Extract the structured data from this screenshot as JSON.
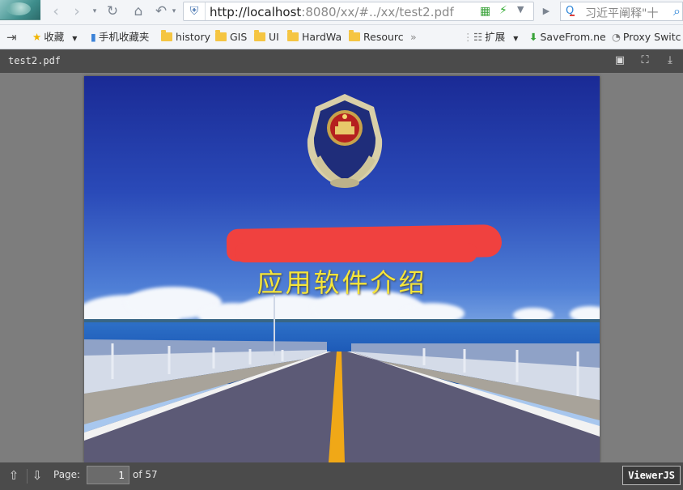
{
  "browser": {
    "url_host": "http://localhost",
    "url_rest": ":8080/xx/#../xx/test2.pdf",
    "search_text": "习近平阐释\"十",
    "back_icon": "back-arrow-icon",
    "forward_icon": "forward-arrow-icon",
    "refresh_icon": "refresh-icon",
    "home_icon": "home-icon",
    "undo_icon": "undo-icon"
  },
  "bookmarks": [
    {
      "label": "收藏",
      "icon": "star-add-icon"
    },
    {
      "label": "手机收藏夹",
      "icon": "phone-icon"
    },
    {
      "label": "history",
      "icon": "folder-icon"
    },
    {
      "label": "GIS",
      "icon": "folder-icon"
    },
    {
      "label": "UI",
      "icon": "folder-icon"
    },
    {
      "label": "HardWa",
      "icon": "folder-icon"
    },
    {
      "label": "Resourc",
      "icon": "folder-icon"
    },
    {
      "label": "扩展",
      "icon": "grid-icon"
    },
    {
      "label": "SaveFrom.ne",
      "icon": "download-arrow-icon"
    },
    {
      "label": "Proxy Switc",
      "icon": "proxy-icon"
    }
  ],
  "viewer": {
    "file_name": "test2.pdf",
    "slide_title": "应用软件介绍",
    "page_label": "Page:",
    "page_value": "1",
    "page_total": "of 57",
    "brand": "ViewerJS"
  },
  "colors": {
    "title_yellow": "#f5e53a",
    "redaction_red": "#f0413f",
    "toolbar_dark": "#4b4b4b"
  }
}
